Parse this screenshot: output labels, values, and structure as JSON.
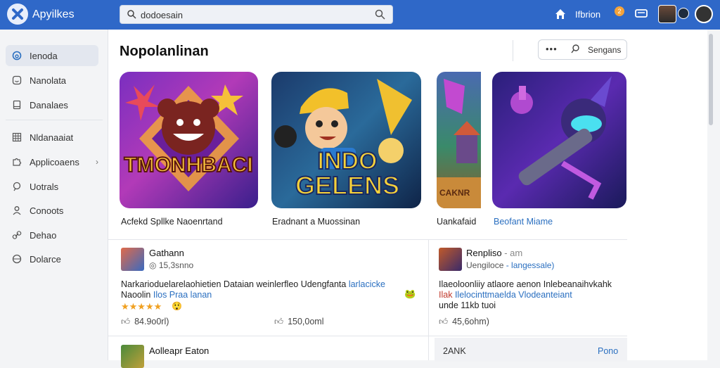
{
  "header": {
    "app_title": "Apyilkes",
    "search_value": "dodoesain",
    "nav_label": "Ifbrion",
    "notification_count": "2"
  },
  "sidebar": {
    "items": [
      {
        "label": "Ienoda",
        "icon": "circle-icon"
      },
      {
        "label": "Nanolata",
        "icon": "smile-icon"
      },
      {
        "label": "Danalaes",
        "icon": "document-icon"
      },
      {
        "label": "Nldanaaiat",
        "icon": "grid-icon"
      },
      {
        "label": "Applicoaens",
        "icon": "puzzle-icon"
      },
      {
        "label": "Uotrals",
        "icon": "pin-icon"
      },
      {
        "label": "Conoots",
        "icon": "person-icon"
      },
      {
        "label": "Dehao",
        "icon": "link-icon"
      },
      {
        "label": "Dolarce",
        "icon": "globe-icon"
      }
    ]
  },
  "main": {
    "heading": "Nopolanlinan",
    "filter_label": "Sengans",
    "cards": [
      {
        "title": "Acfekd Spllke Naoenrtand",
        "art_text": "TMONHBACI"
      },
      {
        "title": "Eradnant a Muossinan",
        "art_text_1": "INDO",
        "art_text_2": "GELENS"
      },
      {
        "title": "Uankafaid",
        "art_text": "CAKNR"
      },
      {
        "title": "Beofant Miame"
      }
    ],
    "posts": [
      {
        "name": "Gathann",
        "meta": "15,3snno",
        "text_line1_a": "Narkarioduelarelaohietien Dataian weinlerfleo Udengfanta ",
        "text_line1_b": "larlacicke",
        "text_line2_a": "Naoolin ",
        "text_line2_b": "Ilos  Praa lanan",
        "stars": "★★★★★",
        "likes_1": "84.9o0rl)",
        "likes_2": "150,0oml"
      },
      {
        "name": "Renpliso",
        "name_suffix": "- am",
        "meta_a": "Uengiloce",
        "meta_b": "- langessale)",
        "text_line1": "Ilaeoloonliiy atlaore aenon Inlebeanaihvkahk",
        "text_line2_a": "Ilak ",
        "text_line2_b": "Ilelocinttmaelda Vlodeanteiant",
        "text_line3": "unde 11kb tuoi",
        "likes": "45,6ohm)"
      }
    ],
    "bottom_post_name": "Aolleapr Eaton",
    "footer_left": "2ANK",
    "footer_right": "Pono"
  },
  "colors": {
    "topbar": "#2f68c8",
    "accent_link": "#2a6fc0",
    "badge": "#f4a23a"
  }
}
